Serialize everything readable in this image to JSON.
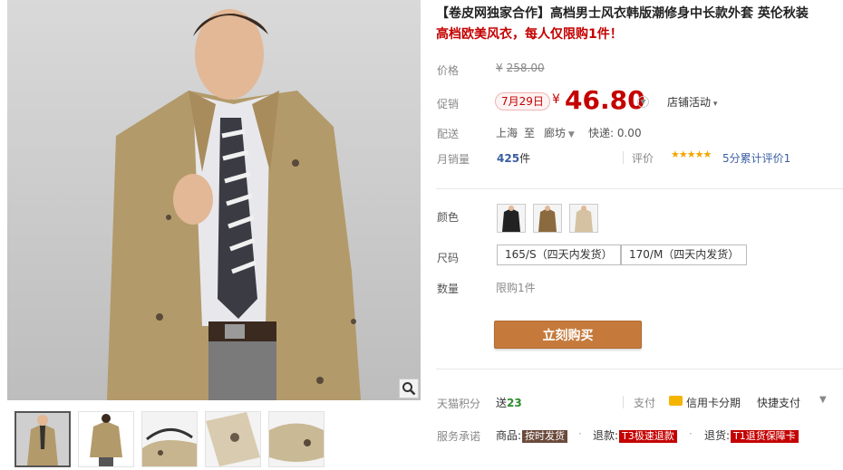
{
  "product": {
    "title": "【卷皮网独家合作】高档男士风衣韩版潮修身中长款外套 英伦秋装",
    "subtitle": "高档欧美风衣，每人仅限购1件！"
  },
  "price": {
    "label": "价格",
    "currency": "¥",
    "original": "258.00"
  },
  "promo": {
    "label": "促销",
    "date": "7月29日",
    "currency": "¥",
    "price": "46.80",
    "shop_activity": "店铺活动"
  },
  "shipping": {
    "label": "配送",
    "from": "上海",
    "to_word": "至",
    "to": "廊坊",
    "express": "快递: 0.00"
  },
  "sales": {
    "label": "月销量",
    "count": "425",
    "unit": "件",
    "review_label": "评价",
    "stars": "★★★★★",
    "score_text": "5分累计评价1"
  },
  "options": {
    "color_label": "颜色",
    "colors": [
      "black-jacket",
      "khaki-jacket",
      "beige-jacket"
    ],
    "size_label": "尺码",
    "sizes": [
      "165/S（四天内发货）",
      "170/M（四天内发货）"
    ],
    "qty_label": "数量",
    "qty_limit": "限购1件"
  },
  "buy_button": "立刻购买",
  "tmall": {
    "points_label": "天猫积分",
    "points_prefix": "送",
    "points": "23",
    "pay_label": "支付",
    "card_text": "信用卡分期",
    "quick_pay": "快捷支付"
  },
  "service": {
    "label": "服务承诺",
    "goods": "商品:",
    "goods_tag": "按时发货",
    "refund": "退款:",
    "refund_tag": "T3极速退款",
    "returns": "退货:",
    "returns_tag": "T1退货保障卡",
    "sep": "·"
  },
  "colors": {
    "accent_red": "#c40000",
    "buy_button": "#c57a3c",
    "link_blue": "#3a5ea3"
  }
}
